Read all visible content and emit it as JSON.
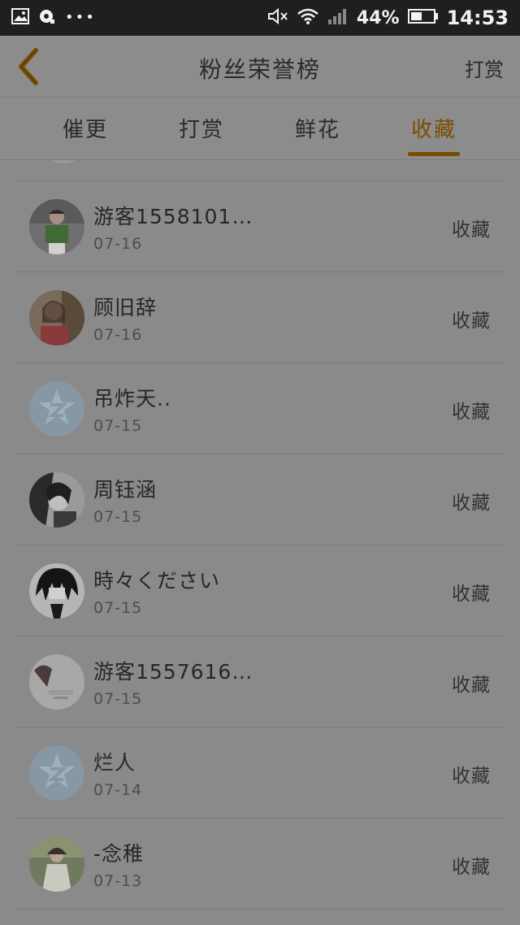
{
  "status_bar": {
    "battery": "44%",
    "time": "14:53"
  },
  "header": {
    "title": "粉丝荣誉榜",
    "action_label": "打赏"
  },
  "tabs": [
    {
      "label": "催更",
      "active": false
    },
    {
      "label": "打赏",
      "active": false
    },
    {
      "label": "鲜花",
      "active": false
    },
    {
      "label": "收藏",
      "active": true
    }
  ],
  "list": {
    "items": [
      {
        "name": "游客1558101…",
        "date": "07-16",
        "action": "收藏",
        "avatar": "photo-green-shirt"
      },
      {
        "name": "顾旧辞",
        "date": "07-16",
        "action": "收藏",
        "avatar": "photo-girl-red"
      },
      {
        "name": "吊炸天..",
        "date": "07-15",
        "action": "收藏",
        "avatar": "default-qq-avatar"
      },
      {
        "name": "周钰涵",
        "date": "07-15",
        "action": "收藏",
        "avatar": "photo-girl-dark"
      },
      {
        "name": "時々ください",
        "date": "07-15",
        "action": "收藏",
        "avatar": "photo-anime-dark"
      },
      {
        "name": "游客1557616…",
        "date": "07-15",
        "action": "收藏",
        "avatar": "photo-girl-light"
      },
      {
        "name": "烂人",
        "date": "07-14",
        "action": "收藏",
        "avatar": "default-qq-avatar"
      },
      {
        "name": "-念稚",
        "date": "07-13",
        "action": "收藏",
        "avatar": "photo-girl-outdoor"
      }
    ]
  },
  "colors": {
    "accent": "#7a4d00",
    "overlay_background": "#8c8c8c",
    "status_bar": "#1f1f1f"
  }
}
